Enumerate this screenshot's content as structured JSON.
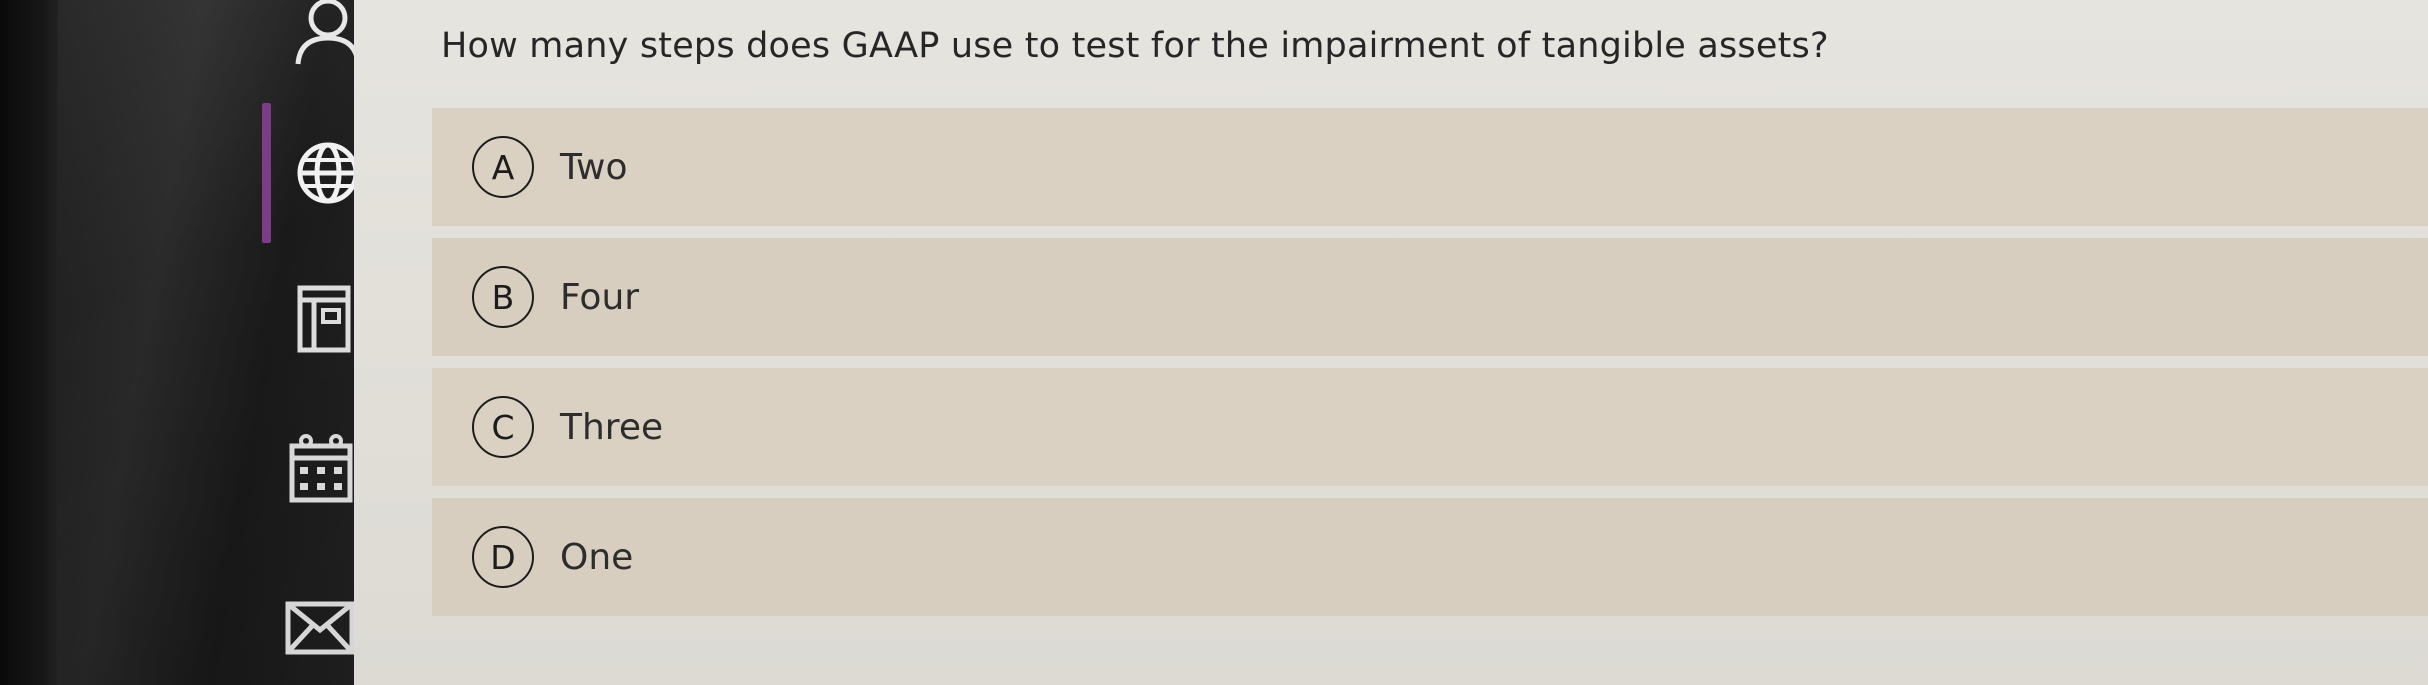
{
  "question": {
    "text": "How many steps does GAAP use to test for the impairment of tangible assets?"
  },
  "options": [
    {
      "letter": "A",
      "text": "Two"
    },
    {
      "letter": "B",
      "text": "Four"
    },
    {
      "letter": "C",
      "text": "Three"
    },
    {
      "letter": "D",
      "text": "One"
    }
  ],
  "sidebar": {
    "icons": [
      "person-icon",
      "globe-icon",
      "book-icon",
      "calendar-icon",
      "mail-icon"
    ],
    "active": "globe-icon"
  },
  "colors": {
    "accent": "#7a3d86",
    "option_bg": "#dbd1c3",
    "content_bg": "#e4e2dc",
    "sidebar_bg": "#242424"
  }
}
